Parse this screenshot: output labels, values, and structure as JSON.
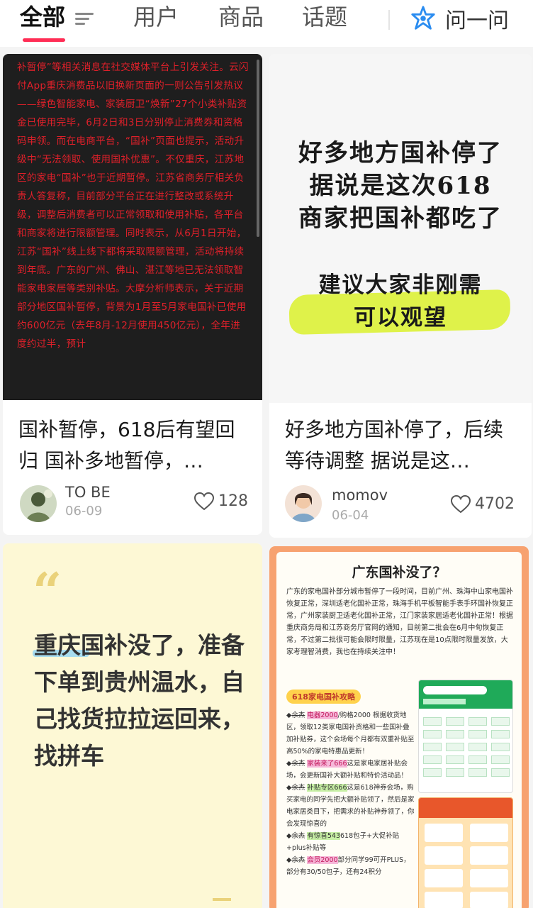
{
  "tabs": [
    {
      "label": "全部",
      "active": true
    },
    {
      "label": "用户",
      "active": false
    },
    {
      "label": "商品",
      "active": false
    },
    {
      "label": "话题",
      "active": false
    }
  ],
  "ask": {
    "label": "问一问"
  },
  "accent_color": "#ff2d55",
  "cards": [
    {
      "image_text": "补暂停”等相关消息在社交媒体平台上引发关注。云闪付App重庆消费品以旧换新页面的一则公告引发热议——绿色智能家电、家装厨卫“焕新”27个小类补贴资金已使用完毕，6月2日和3日分别停止消费券和资格码申领。而在电商平台，“国补”页面也提示，活动升级中“无法领取、使用国补优惠”。不仅重庆，江苏地区的家电“国补”也于近期暂停。江苏省商务厅相关负责人答复称，目前部分平台正在进行整改或系统升级，调整后消费者可以正常领取和使用补贴，各平台和商家将进行限额管理。同时表示，从6月1日开始，江苏“国补”线上线下都将采取限额管理，活动将持续到年底。广东的广州、佛山、湛江等地已无法领取智能家电家居等类别补贴。大摩分析师表示，关于近期部分地区国补暂停，背景为1月至5月家电国补已使用约600亿元（去年8月-12月使用450亿元），全年进度约过半，预计",
      "title": "国补暂停，618后有望回归 国补多地暂停，…",
      "author": "TO BE",
      "date": "06-09",
      "likes": "128"
    },
    {
      "image_lines": [
        "好多地方国补停了",
        "据说是这次618",
        "商家把国补都吃了",
        "建议大家非刚需",
        "可以观望"
      ],
      "title": "好多地方国补停了，后续等待调整 据说是这…",
      "author": "momov",
      "date": "06-04",
      "likes": "4702"
    },
    {
      "quote_mark": "“",
      "image_text": "重庆国补没了，准备下单到贵州温水，自己找货拉拉运回来，找拼车"
    },
    {
      "image_title": "广东国补没了？",
      "image_paragraph": "广东的家电国补部分城市暂停了一段时间，目前广州、珠海中山家电国补恢复正常，深圳适老化国补正常，珠海手机平板智能手表手环国补恢复正常，广州家装厨卫适老化国补正常，江门家装家居适老化国补正常！根据重庆商务局和江苏商务厅官网的通知，目前第二批会在6月中旬恢复正常，不过第二批很可能会限时限量，江苏现在是10点限时限量发放，大家考理智消费，我也在持续关注中！",
      "badge": "618家电国补攻略",
      "list": [
        {
          "strike": "余杰",
          "hl": "电器2000",
          "rest": "/购格2000 根据收货地区，领取12类家电国补资格和一些国补叠加补贴券，这个会场每个月都有双重补贴至高50%的家电特惠品更新！"
        },
        {
          "strike": "余杰",
          "hl": "家装来了666",
          "rest": "这是家电家居补贴会场，会更新国补大额补贴和特价活动品！"
        },
        {
          "strike": "余杰",
          "hl": "补贴专区666",
          "rest": "这是618神券会场，购买家电的同学先把大额补贴领了，然后是家电家居类目下，把需求的补贴神券领了，你会发现惊喜的"
        },
        {
          "strike": "余杰",
          "hl": "有惊喜543",
          "rest": "618包子+大促补贴+plus补贴等"
        },
        {
          "strike": "余杰",
          "hl": "会员2000",
          "rest": "部分同学99可开PLUS，部分有30/50包子，还有24积分"
        }
      ]
    }
  ]
}
